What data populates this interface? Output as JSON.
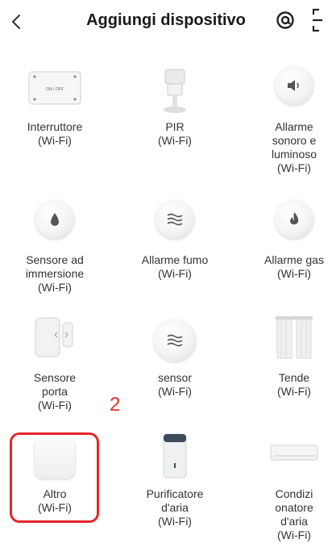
{
  "header": {
    "title": "Aggiungi dispositivo",
    "back_icon": "chevron-left-icon",
    "at_icon": "at-sign-icon",
    "scan_icon": "scan-icon"
  },
  "devices": [
    {
      "label": "Interruttore\n(Wi-Fi)",
      "switch_text": "ON / OFF"
    },
    {
      "label": "PIR\n(Wi-Fi)"
    },
    {
      "label": "Allarme\nsonoro e\nluminoso\n(Wi-Fi)"
    },
    {
      "label": "Sensore ad\nimmersione\n(Wi-Fi)"
    },
    {
      "label": "Allarme fumo\n(Wi-Fi)"
    },
    {
      "label": "Allarme gas\n(Wi-Fi)"
    },
    {
      "label": "Sensore\nporta\n(Wi-Fi)"
    },
    {
      "label": "sensor\n(Wi-Fi)"
    },
    {
      "label": "Tende\n(Wi-Fi)"
    },
    {
      "label": "Altro\n(Wi-Fi)"
    },
    {
      "label": "Purificatore\nd'aria\n(Wi-Fi)"
    },
    {
      "label": "Condizi\nonatore\nd'aria\n(Wi-Fi)"
    }
  ],
  "annotation": {
    "number": "2",
    "color": "#e3262b"
  }
}
